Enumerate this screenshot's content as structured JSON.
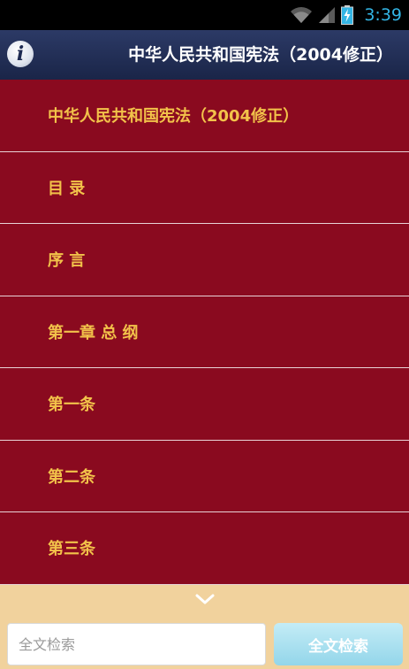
{
  "status_bar": {
    "time": "3:39",
    "icons": [
      "wifi-icon",
      "signal-icon",
      "battery-charging-icon"
    ],
    "clock_color": "#33b5e5"
  },
  "header": {
    "title": "中华人民共和国宪法（2004修正）",
    "info_icon": "info-icon",
    "background": "#1f2a50"
  },
  "menu": {
    "items": [
      "中华人民共和国宪法（2004修正）",
      "目 录",
      "序 言",
      "第一章 总 纲",
      "第一条",
      "第二条",
      "第三条"
    ],
    "background": "#8a0a1f",
    "text_color": "#f2c24a"
  },
  "footer": {
    "expand_icon": "chevron-down-icon",
    "search_placeholder": "全文检索",
    "search_button_label": "全文检索",
    "background": "#f1d29d"
  }
}
